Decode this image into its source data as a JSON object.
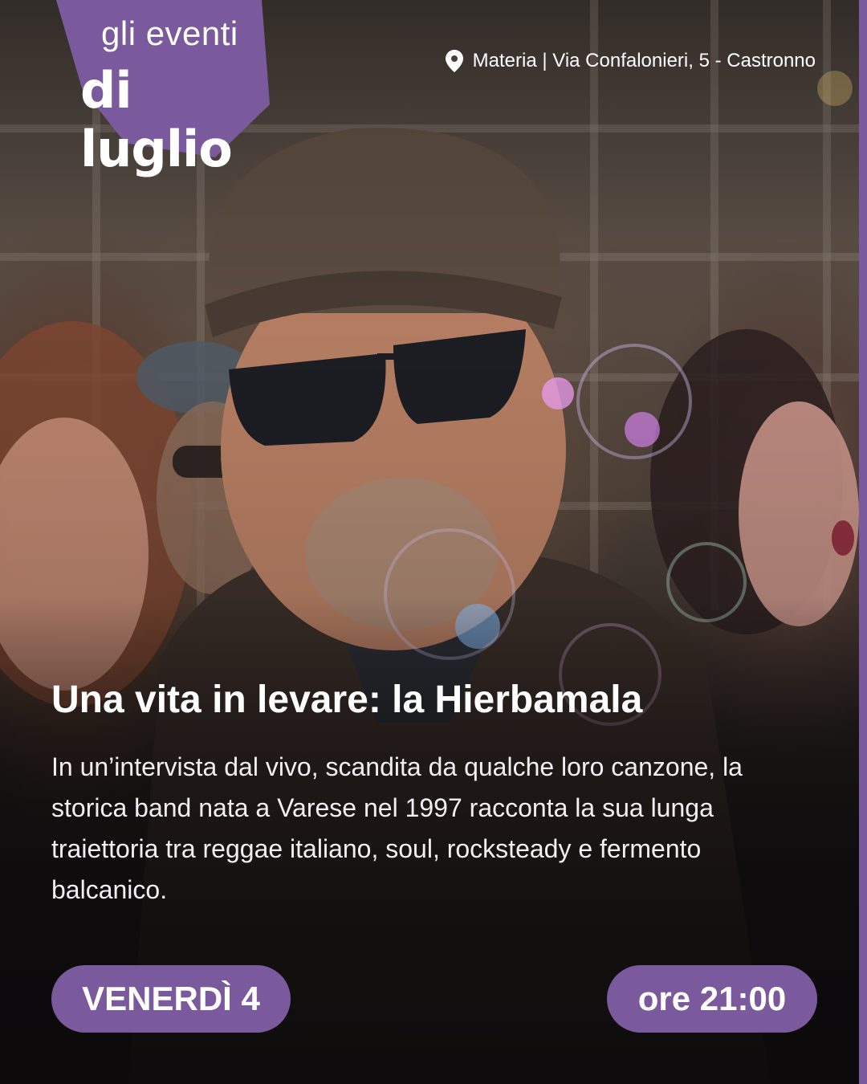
{
  "badge": {
    "line1": "gli eventi",
    "line2": "di luglio"
  },
  "location": {
    "icon": "map-pin-icon",
    "text": "Materia | Via Confalonieri, 5 - Castronno"
  },
  "event": {
    "title": "Una vita in levare: la Hierbamala",
    "description": "In un’intervista dal vivo, scandita da qualche loro canzone, la storica band nata a Varese nel 1997 racconta la sua lunga traiettoria tra reggae italiano, soul, rocksteady e fermento balcanico.",
    "date": "VENERDÌ 4",
    "time": "ore 21:00"
  },
  "colors": {
    "accent": "#7a5a9c",
    "text": "#ffffff",
    "background": "#0d0c0d"
  }
}
